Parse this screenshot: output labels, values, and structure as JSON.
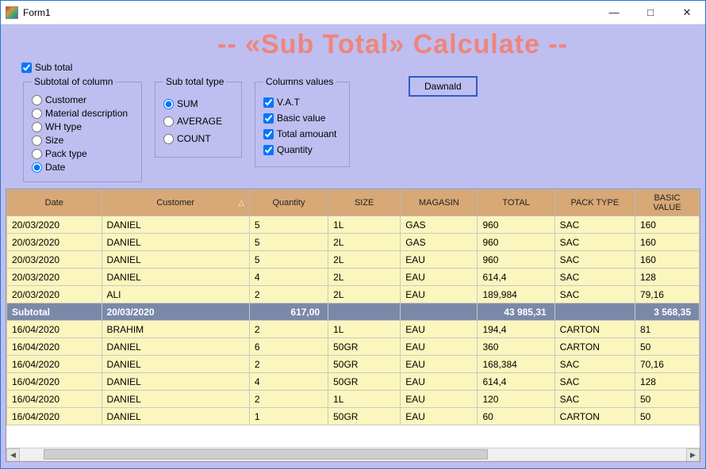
{
  "window": {
    "title": "Form1"
  },
  "heading": "--  «Sub Total» Calculate   --",
  "subtotal_checkbox": {
    "label": "Sub total",
    "checked": true
  },
  "group_column": {
    "legend": "Subtotal of column",
    "options": [
      {
        "label": "Customer",
        "selected": false
      },
      {
        "label": "Material description",
        "selected": false
      },
      {
        "label": "WH type",
        "selected": false
      },
      {
        "label": "Size",
        "selected": false
      },
      {
        "label": "Pack type",
        "selected": false
      },
      {
        "label": "Date",
        "selected": true
      }
    ]
  },
  "group_type": {
    "legend": "Sub total type",
    "options": [
      {
        "label": "SUM",
        "selected": true
      },
      {
        "label": "AVERAGE",
        "selected": false
      },
      {
        "label": "COUNT",
        "selected": false
      }
    ]
  },
  "group_values": {
    "legend": "Columns values",
    "options": [
      {
        "label": "V.A.T",
        "checked": true
      },
      {
        "label": "Basic value",
        "checked": true
      },
      {
        "label": "Total amouant",
        "checked": true
      },
      {
        "label": "Quantity",
        "checked": true
      }
    ]
  },
  "download_button": "Dawnald",
  "grid": {
    "columns": [
      "Date",
      "Customer",
      "Quantity",
      "SIZE",
      "MAGASIN",
      "TOTAL",
      "PACK TYPE",
      "BASIC VALUE"
    ],
    "sort_column_index": 1,
    "rows": [
      {
        "cells": [
          "20/03/2020",
          "DANIEL",
          "5",
          "1L",
          "GAS",
          "960",
          "SAC",
          "160"
        ]
      },
      {
        "cells": [
          "20/03/2020",
          "DANIEL",
          "5",
          "2L",
          "GAS",
          "960",
          "SAC",
          "160"
        ]
      },
      {
        "cells": [
          "20/03/2020",
          "DANIEL",
          "5",
          "2L",
          "EAU",
          "960",
          "SAC",
          "160"
        ]
      },
      {
        "cells": [
          "20/03/2020",
          "DANIEL",
          "4",
          "2L",
          "EAU",
          "614,4",
          "SAC",
          "128"
        ]
      },
      {
        "cells": [
          "20/03/2020",
          "ALI",
          "2",
          "2L",
          "EAU",
          "189,984",
          "SAC",
          "79,16"
        ]
      },
      {
        "subtotal": true,
        "cells": [
          "Subtotal",
          "20/03/2020",
          "617,00",
          "",
          "",
          "43 985,31",
          "",
          "3 568,35"
        ]
      },
      {
        "cells": [
          "16/04/2020",
          "BRAHIM",
          "2",
          "1L",
          "EAU",
          "194,4",
          "CARTON",
          "81"
        ]
      },
      {
        "cells": [
          "16/04/2020",
          "DANIEL",
          "6",
          "50GR",
          "EAU",
          "360",
          "CARTON",
          "50"
        ]
      },
      {
        "cells": [
          "16/04/2020",
          "DANIEL",
          "2",
          "50GR",
          "EAU",
          "168,384",
          "SAC",
          "70,16"
        ]
      },
      {
        "cells": [
          "16/04/2020",
          "DANIEL",
          "4",
          "50GR",
          "EAU",
          "614,4",
          "SAC",
          "128"
        ]
      },
      {
        "cells": [
          "16/04/2020",
          "DANIEL",
          "2",
          "1L",
          "EAU",
          "120",
          "SAC",
          "50"
        ]
      },
      {
        "cells": [
          "16/04/2020",
          "DANIEL",
          "1",
          "50GR",
          "EAU",
          "60",
          "CARTON",
          "50"
        ]
      }
    ]
  }
}
